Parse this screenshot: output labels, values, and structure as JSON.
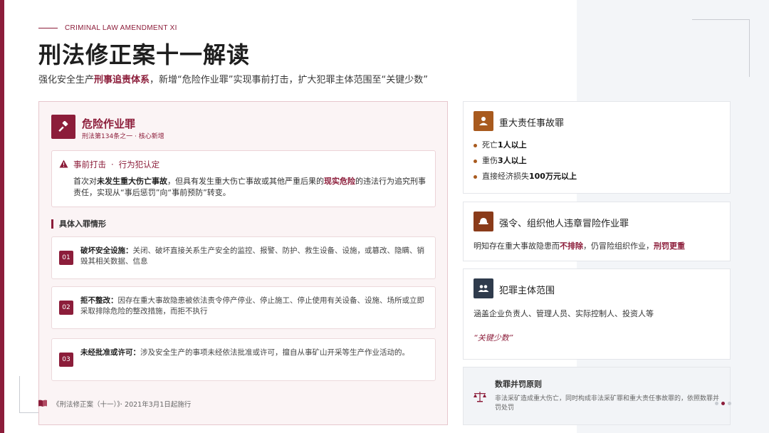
{
  "header": {
    "eyebrow": "CRIMINAL LAW AMENDMENT XI",
    "title": "刑法修正案十一解读",
    "subtitle_pre": "强化安全生产",
    "subtitle_bold": "刑事追责体系",
    "subtitle_post": "，新增“危险作业罪”实现事前打击，扩大犯罪主体范围至“关键少数”"
  },
  "main_card": {
    "icon": "gavel-icon",
    "title": "危险作业罪",
    "subtitle": "刑法第134条之一 · 核心新增",
    "warning": {
      "icon": "warning-icon",
      "head_a": "事前打击",
      "sep": "·",
      "head_b": "行为犯认定",
      "t1": "首次对",
      "t2": "未发生重大伤亡事故",
      "t3": "，但具有发生重大伤亡事故或其他严重后果的",
      "t4": "现实危险",
      "t5": "的违法行为追究刑事责任，实现从“事后惩罚”向“事前预防”转变。"
    },
    "section_title": "具体入罪情形",
    "items": [
      {
        "num": "01",
        "label": "破坏安全设施：",
        "text": "关闭、破坏直接关系生产安全的监控、报警、防护、救生设备、设施，或篡改、隐瞒、销毁其相关数据、信息"
      },
      {
        "num": "02",
        "label": "拒不整改：",
        "text": "因存在重大事故隐患被依法责令停产停业、停止施工、停止使用有关设备、设施、场所或立即采取排除危险的整改措施，而拒不执行"
      },
      {
        "num": "03",
        "label": "未经批准或许可：",
        "text": "涉及安全生产的事项未经依法批准或许可，擅自从事矿山开采等生产作业活动的。"
      }
    ]
  },
  "footnote": {
    "icon": "book-icon",
    "text": "《刑法修正案（十一）》· 2021年3月1日起施行"
  },
  "side": {
    "major_accident": {
      "icon": "worker-icon",
      "title": "重大责任事故罪",
      "bullets": [
        {
          "pre": "死亡",
          "bold": "1人以上",
          "post": ""
        },
        {
          "pre": "重伤",
          "bold": "3人以上",
          "post": ""
        },
        {
          "pre": "直接经济损失",
          "bold": "100万元以上",
          "post": ""
        }
      ]
    },
    "forced_risk": {
      "icon": "helmet-icon",
      "title": "强令、组织他人违章冒险作业罪",
      "t1": "明知存在重大事故隐患而",
      "t2": "不排除",
      "t3": "，仍冒险组织作业，",
      "t4": "刑罚更重"
    },
    "subject_scope": {
      "icon": "people-icon",
      "title": "犯罪主体范围",
      "text": "涵盖企业负责人、管理人员、实际控制人、投资人等",
      "quote": "“关键少数”"
    },
    "principle": {
      "icon": "scale-icon",
      "title": "数罪并罚原则",
      "text": "非法采矿造成重大伤亡，同时构成非法采矿罪和重大责任事故罪的，依照数罪并罚处罚"
    }
  },
  "colors": {
    "accent": "#8c1d3a",
    "orange": "#a85a1e",
    "navy": "#2f3b4c"
  }
}
